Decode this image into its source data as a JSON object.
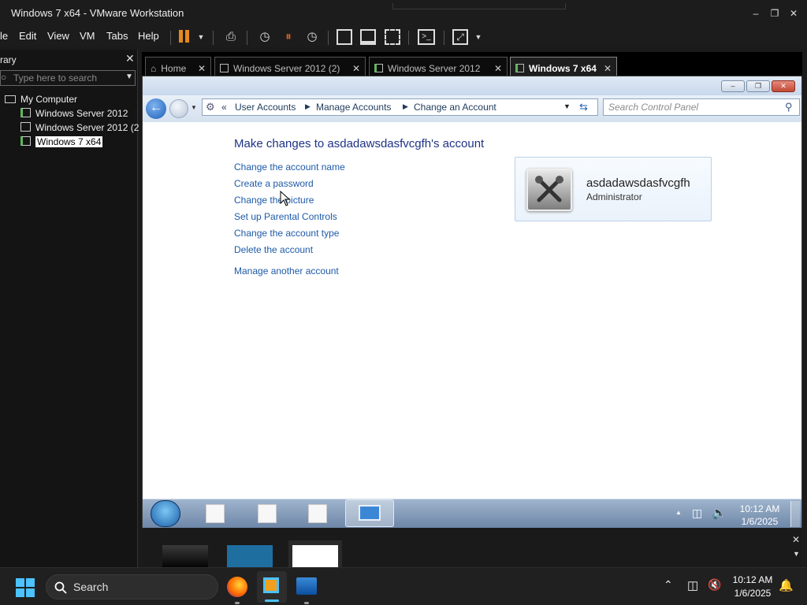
{
  "window": {
    "title": "Windows 7 x64 - VMware Workstation"
  },
  "menu": [
    "le",
    "Edit",
    "View",
    "VM",
    "Tabs",
    "Help"
  ],
  "library": {
    "title": "rary",
    "search_placeholder": "Type here to search",
    "tree": [
      {
        "label": "My Computer",
        "icon": "computer-icon"
      },
      {
        "label": "Windows Server 2012",
        "icon": "vm-icon"
      },
      {
        "label": "Windows Server 2012 (2",
        "icon": "vm-off-icon"
      },
      {
        "label": "Windows 7 x64",
        "icon": "vm-running-icon",
        "selected": true
      }
    ]
  },
  "tabs": [
    {
      "label": "Home",
      "icon": "home-icon"
    },
    {
      "label": "Windows Server 2012 (2)",
      "icon": "vm-off-icon"
    },
    {
      "label": "Windows Server 2012",
      "icon": "vm-icon"
    },
    {
      "label": "Windows 7 x64",
      "icon": "vm-running-icon",
      "active": true
    }
  ],
  "guest": {
    "breadcrumb": {
      "prefix": "«",
      "items": [
        "User Accounts",
        "Manage Accounts",
        "Change an Account"
      ]
    },
    "search_placeholder": "Search Control Panel",
    "heading": "Make changes to asdadawsdasfvcgfh's account",
    "links": [
      "Change the account name",
      "Create a password",
      "Change the picture",
      "Set up Parental Controls",
      "Change the account type",
      "Delete the account"
    ],
    "manage_link": "Manage another account",
    "account": {
      "name": "asdadawsdasfvcgfh",
      "role": "Administrator"
    },
    "clock": {
      "time": "10:12 AM",
      "date": "1/6/2025"
    }
  },
  "host_taskbar": {
    "search_placeholder": "Search",
    "clock": {
      "time": "10:12 AM",
      "date": "1/6/2025"
    }
  },
  "colors": {
    "accent_pause": "#e8891c",
    "link": "#1e5aa8",
    "heading": "#1e3287"
  }
}
